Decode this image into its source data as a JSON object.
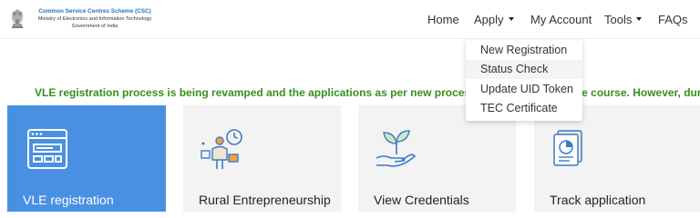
{
  "brand": {
    "title": "Common Service Centres Scheme (CSC)",
    "ministry": "Ministry of Electronics and Information Technology",
    "government": "Government of India"
  },
  "nav": {
    "home": "Home",
    "apply": "Apply",
    "my_account": "My Account",
    "tools": "Tools",
    "faqs": "FAQs"
  },
  "apply_menu": {
    "items": [
      "New Registration",
      "Status Check",
      "Update UID Token",
      "TEC Certificate"
    ],
    "hovered": "Status Check"
  },
  "announcement": "VLE registration process is being revamped and the applications as per new process will be started in due course. However, during the cu",
  "cards": [
    {
      "label": "VLE registration",
      "icon": "browser-window-icon",
      "active": true
    },
    {
      "label": "Rural Entrepreneurship",
      "icon": "entrepreneur-icon",
      "active": false
    },
    {
      "label": "View Credentials",
      "icon": "plant-hand-icon",
      "active": false
    },
    {
      "label": "Track application",
      "icon": "document-pie-chart-icon",
      "active": false
    }
  ],
  "colors": {
    "brand_blue": "#2a6fb8",
    "active_card": "#4a90e2",
    "card_bg": "#f3f3f3",
    "announcement_green": "#3a8f1c",
    "icon_blue": "#3a7bc8"
  }
}
